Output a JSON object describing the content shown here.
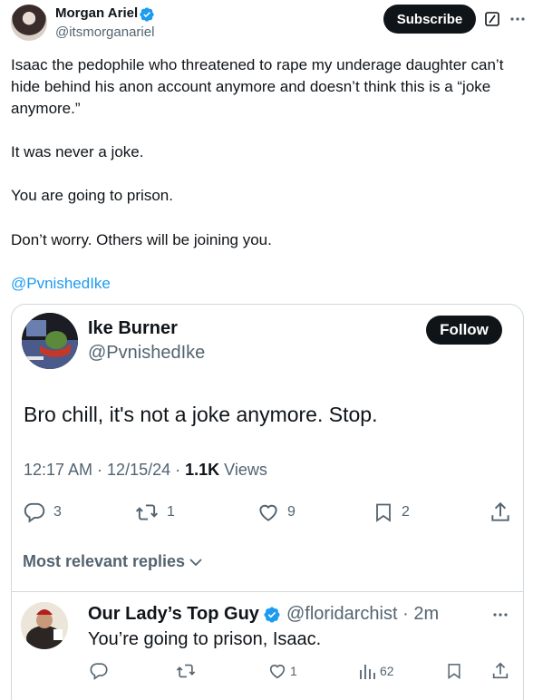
{
  "author": {
    "name": "Morgan Ariel",
    "handle": "@itsmorganariel",
    "subscribe_label": "Subscribe"
  },
  "tweet": {
    "paragraphs": [
      "Isaac the pedophile who threatened to rape my underage daughter can’t hide behind his anon account anymore and doesn’t think this is a “joke anymore.”",
      "It was never a joke.",
      "You are going to prison.",
      "Don’t worry. Others will be joining you."
    ],
    "mention": "@PvnishedIke"
  },
  "quote": {
    "name": "Ike Burner",
    "handle": "@PvnishedIke",
    "follow_label": "Follow",
    "text": "Bro chill, it's not a joke anymore. Stop.",
    "meta_time": "12:17 AM · 12/15/24 · ",
    "meta_views_count": "1.1K",
    "meta_views_label": " Views",
    "actions": {
      "replies": "3",
      "reposts": "1",
      "likes": "9",
      "bookmarks": "2"
    },
    "relevant_label": "Most relevant replies"
  },
  "reply": {
    "name": "Our Lady’s Top Guy",
    "handle": "@floridarchist · 2m",
    "text": "You’re going to prison, Isaac.",
    "actions": {
      "reposts": "",
      "likes": "1",
      "views": "62"
    }
  },
  "colors": {
    "accent": "#1d9bf0",
    "text": "#0f1419",
    "muted": "#536471",
    "border": "#cfd9de"
  }
}
